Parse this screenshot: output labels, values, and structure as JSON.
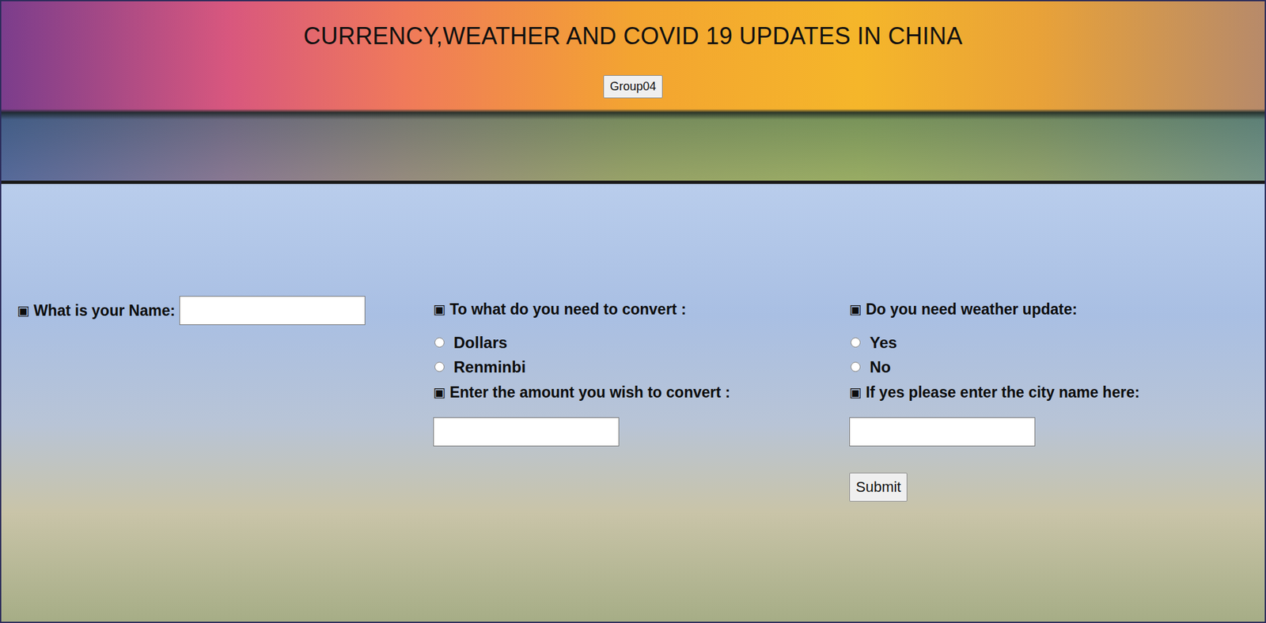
{
  "header": {
    "title": "CURRENCY,WEATHER AND COVID 19 UPDATES IN CHINA",
    "button": "Group04"
  },
  "form": {
    "name": {
      "marker": "▣",
      "label": "What is your Name:",
      "value": ""
    },
    "currency": {
      "marker": "▣",
      "label": "To what do you need to convert :",
      "options": [
        {
          "label": "Dollars",
          "selected": false
        },
        {
          "label": "Renminbi",
          "selected": false
        }
      ]
    },
    "amount": {
      "marker": "▣",
      "label": "Enter the amount you wish to convert :",
      "value": ""
    },
    "weather": {
      "marker": "▣",
      "label": "Do you need weather update:",
      "options": [
        {
          "label": "Yes",
          "selected": false
        },
        {
          "label": "No",
          "selected": false
        }
      ]
    },
    "city": {
      "marker": "▣",
      "label": "If yes please enter the city name here:",
      "value": ""
    },
    "submit": "Submit"
  }
}
